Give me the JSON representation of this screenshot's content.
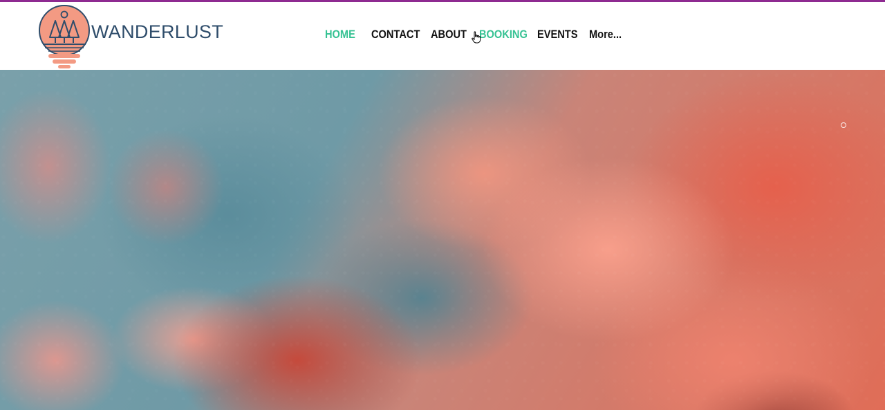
{
  "brand": {
    "name": "WANDERLUST",
    "colors": {
      "coral": "#f08a73",
      "navy": "#2f4d6b",
      "accent_green": "#36c293",
      "top_border": "#8e2a91"
    }
  },
  "nav": {
    "items": [
      {
        "label": "HOME",
        "state": "active"
      },
      {
        "label": "CONTACT",
        "state": "default"
      },
      {
        "label": "ABOUT",
        "state": "default"
      },
      {
        "label": "BOOKING",
        "state": "hover"
      },
      {
        "label": "EVENTS",
        "state": "default"
      },
      {
        "label": "More...",
        "state": "default"
      }
    ]
  },
  "hero": {
    "image": "pink-red-clouds-on-blue-sky",
    "slide_count": 1
  },
  "icons": {
    "logo": "trees-in-sun-logo-icon",
    "cursor": "hand-pointer-icon"
  }
}
